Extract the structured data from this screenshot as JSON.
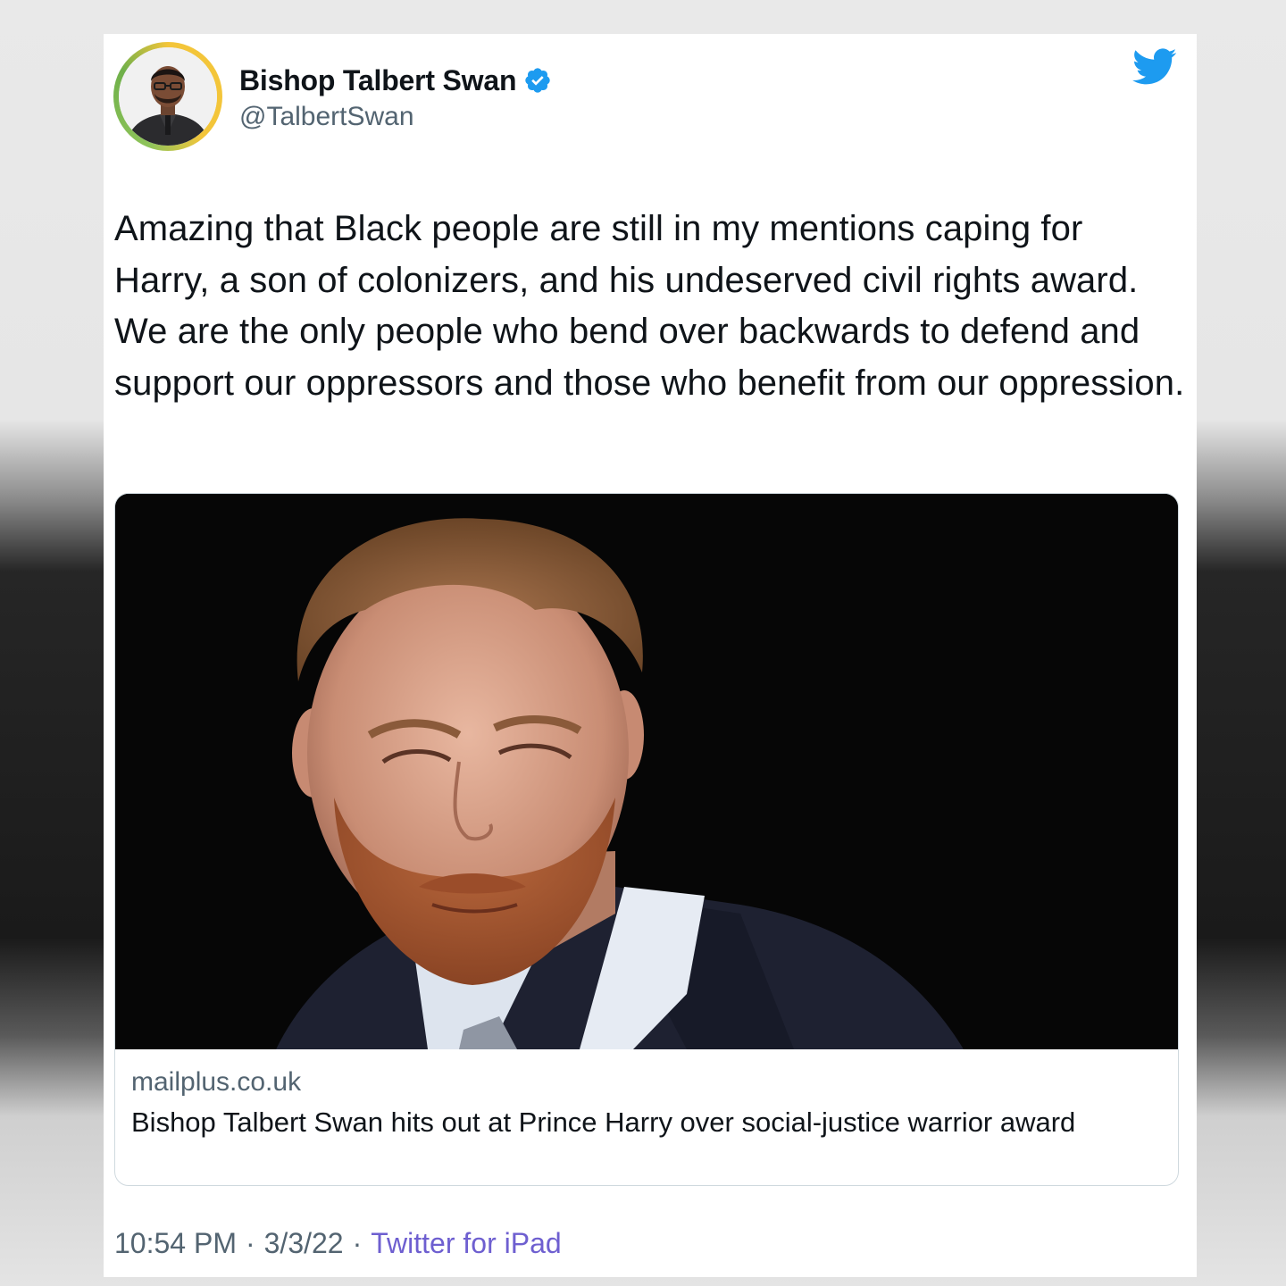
{
  "author": {
    "display_name": "Bishop Talbert Swan",
    "handle": "@TalbertSwan",
    "verified": true,
    "avatar_icon": "profile-photo"
  },
  "brand": {
    "logo_icon": "twitter-bird-icon",
    "accent_color": "#1d9bf0"
  },
  "tweet": {
    "text": "Amazing that Black people are still in my mentions caping for Harry, a son of colonizers, and his undeserved civil rights award. We are the only people who bend over backwards to defend and support our oppressors and those who benefit from our oppression."
  },
  "link_card": {
    "domain": "mailplus.co.uk",
    "title": "Bishop Talbert Swan hits out at Prince Harry over social-justice warrior award"
  },
  "meta": {
    "time": "10:54 PM",
    "date": "3/3/22",
    "source": "Twitter for iPad",
    "separator": "·",
    "source_color": "#6e5fd0"
  }
}
